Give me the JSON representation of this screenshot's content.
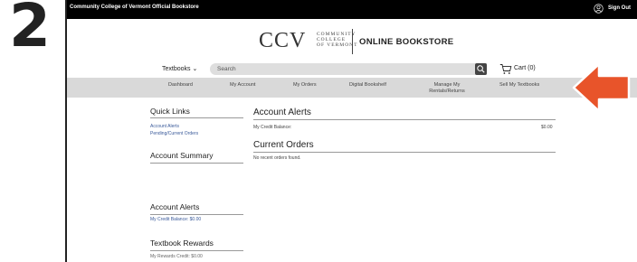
{
  "step_number": "2",
  "topbar": {
    "store_name": "Community College of Vermont Official Bookstore",
    "signout_label": "Sign Out"
  },
  "logo": {
    "ccv": "CCV",
    "line1": "COMMUNITY",
    "line2": "COLLEGE",
    "line3": "OF VERMONT",
    "site_title": "ONLINE BOOKSTORE"
  },
  "search": {
    "category_label": "Textbooks",
    "placeholder": "Search",
    "cart_label": "Cart (0)"
  },
  "nav": {
    "items": [
      {
        "label": "Dashboard"
      },
      {
        "label": "My Account"
      },
      {
        "label": "My Orders"
      },
      {
        "label": "Digital Bookshelf"
      },
      {
        "label": "Manage My Rentals/Returns"
      },
      {
        "label": "Sell My Textbooks"
      }
    ]
  },
  "sidebar": {
    "quick_links_title": "Quick Links",
    "quick_links": [
      "Account Alerts",
      "Pending/Current Orders"
    ],
    "account_summary_title": "Account Summary",
    "account_alerts_title": "Account Alerts",
    "credit_balance": "My Credit Balance: $0.00",
    "rewards_title": "Textbook Rewards",
    "rewards_credit": "My Rewards Credit: $0.00"
  },
  "main": {
    "alerts_title": "Account Alerts",
    "credit_label": "My Credit Balance:",
    "credit_value": "$0.00",
    "orders_title": "Current Orders",
    "orders_empty": "No recent orders found."
  },
  "colors": {
    "arrow": "#e8542a",
    "nav_bg": "#d9d9d9",
    "topbar_bg": "#000000"
  }
}
